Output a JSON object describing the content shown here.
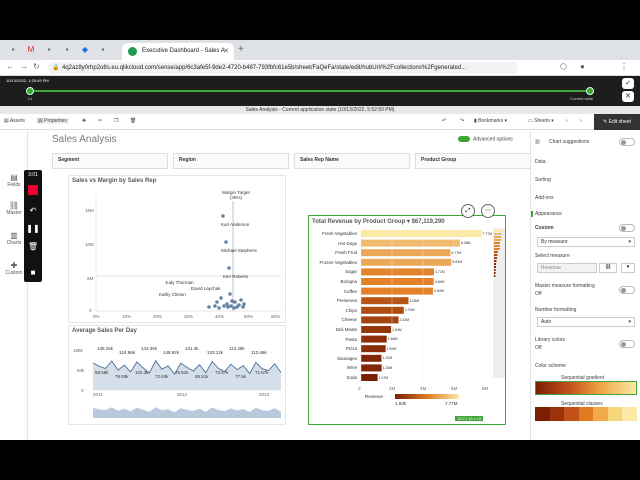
{
  "browser": {
    "tab_title": "Executive Dashboard - Sales A",
    "url": "4q2az8y0rhp2o8s.eu.qlikcloud.com/sense/app/6c3afe5f-9de2-4720-b487-793fbfc61e5b/sheet/FaQeFa/state/edit/hubUrl/%2Fcollections%2Fgenerated..."
  },
  "timeline": {
    "timestamp": "10/13/2022, 1:25:49 PM",
    "step": "x1",
    "current": "Current state"
  },
  "app": {
    "title": "Sales Analysis - Current application state (10/13/2022, 5:52:50 PM)",
    "toolbar": {
      "assets": "Assets",
      "properties": "Properties",
      "bookmarks": "Bookmarks",
      "sheets": "Sheets",
      "edit_sheet": "Edit sheet"
    }
  },
  "rail": {
    "fields": "Fields",
    "master": "Master",
    "charts": "Charts",
    "custom": "Custom"
  },
  "recorder": {
    "time": "3:01"
  },
  "sheet": {
    "title": "Sales Analysis",
    "advanced_options": "Advanced options",
    "filters": [
      "Segment",
      "Region",
      "Sales Rep Name",
      "Product Group"
    ]
  },
  "scatter": {
    "title": "Sales vs Margin by Sales Rep",
    "y_ticks": [
      "15M",
      "10M",
      "5M",
      "0"
    ],
    "x_ticks": [
      "0%",
      "10%",
      "20%",
      "30%",
      "40%",
      "50%",
      "60%"
    ],
    "labels": [
      "Margin Target (45%)",
      "Karl Anderson",
      "Michael Stephens",
      "Ken Roberts",
      "Judy Thurman",
      "David Laychak",
      "Kathy Clinton"
    ]
  },
  "line": {
    "title": "Average Sales Per Day",
    "y_ticks": [
      "168k",
      "84k",
      "0"
    ],
    "x_ticks": [
      "2011",
      "2012",
      "2013"
    ],
    "values": [
      "138.26k",
      "124.96k",
      "143.35k",
      "148.92k",
      "131.3k",
      "133.12k",
      "113.48k",
      "113.46k",
      "98.58k",
      "79.93k",
      "102.3k",
      "72.63k",
      "76.51k",
      "85.51k",
      "73.57k",
      "77.5k",
      "71.57k"
    ]
  },
  "chart_data": {
    "type": "bar",
    "title": "Total Revenue by Product Group ▾ $67,119,290",
    "categories": [
      "Fresh Vegetables",
      "Hot Dogs",
      "Fresh Fruit",
      "Frozen Vegetables",
      "Sugar",
      "Bologna",
      "Coffee",
      "Preserves",
      "Chips",
      "Cheese",
      "Deli Meats",
      "Pasta",
      "Pizza",
      "Sausages",
      "Wine",
      "Soda"
    ],
    "values": [
      7.77,
      6.38,
      5.77,
      5.83,
      4.71,
      4.69,
      4.64,
      3.06,
      2.76,
      2.42,
      1.94,
      1.66,
      1.59,
      1.32,
      1.33,
      1.07
    ],
    "data_labels": [
      "7.77M",
      "6.38M",
      "5.77M",
      "5.83M",
      "4.71M",
      "4.69M",
      "4.64M",
      "3.06M",
      "2.76M",
      "2.42M",
      "1.94M",
      "1.66M",
      "1.59M",
      "1.32M",
      "1.33M",
      "1.07M"
    ],
    "x_ticks": [
      "0",
      "2M",
      "4M",
      "6M",
      "8M"
    ],
    "xlim": [
      0,
      8
    ],
    "legend_label": "Revenue",
    "legend_min": "1.93k",
    "legend_max": "7.77M",
    "size_badge": "13.2 | 10 x 10"
  },
  "props": {
    "header": "Chart suggestions",
    "items": [
      "Data",
      "Sorting",
      "Add-ons",
      "Appearance"
    ],
    "custom": "Custom",
    "by_measure": "By measure",
    "select_measure": "Select measure",
    "measure_value": "Revenue",
    "master_measure_formatting": "Master measure formatting",
    "off": "Off",
    "number_formatting": "Number formatting",
    "auto": "Auto",
    "library_colors": "Library colors",
    "off2": "Off",
    "color_scheme": "Color scheme",
    "sequential_gradient": "Sequential gradient",
    "sequential_classes": "Sequential classes"
  },
  "colors": {
    "accent": "#3fa535",
    "bar_dark": "#8b2d08",
    "bar_light": "#f7d57a"
  }
}
